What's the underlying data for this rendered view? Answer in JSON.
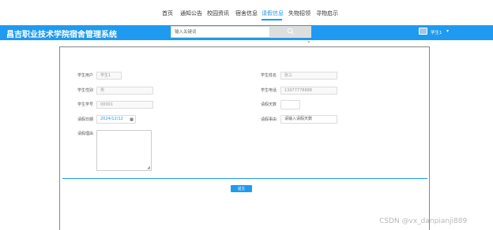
{
  "nav": {
    "items": [
      {
        "label": "首页",
        "active": false
      },
      {
        "label": "通知公告",
        "active": false
      },
      {
        "label": "校园资讯",
        "active": false
      },
      {
        "label": "宿舍信息",
        "active": false
      },
      {
        "label": "请假信息",
        "active": true
      },
      {
        "label": "失物招领",
        "active": false
      },
      {
        "label": "寻物启示",
        "active": false
      }
    ]
  },
  "header": {
    "site_title": "昌吉职业技术学院宿舍管理系统",
    "search_placeholder": "输入关键词",
    "user_name": "学生1"
  },
  "form": {
    "student_account": {
      "label": "学生用户",
      "value": "学生1"
    },
    "student_name": {
      "label": "学生姓名",
      "value": "张三"
    },
    "student_gender": {
      "label": "学生性别",
      "value": "男"
    },
    "student_phone": {
      "label": "学生电话",
      "value": "13977778888"
    },
    "student_id": {
      "label": "学生学号",
      "value": "00001"
    },
    "leave_days": {
      "label": "请假天数",
      "value": ""
    },
    "leave_date": {
      "label": "请假日期",
      "value": "2024/12/12"
    },
    "leave_reason": {
      "label": "请假事由",
      "value": "请输入请假天数"
    },
    "leave_remark": {
      "label": "请假理由",
      "value": ""
    },
    "submit_label": "提交"
  },
  "watermark": "CSDN @vx_danpianji889",
  "colors": {
    "accent": "#1e9bf0",
    "header_bg": "#1e9bf0"
  }
}
